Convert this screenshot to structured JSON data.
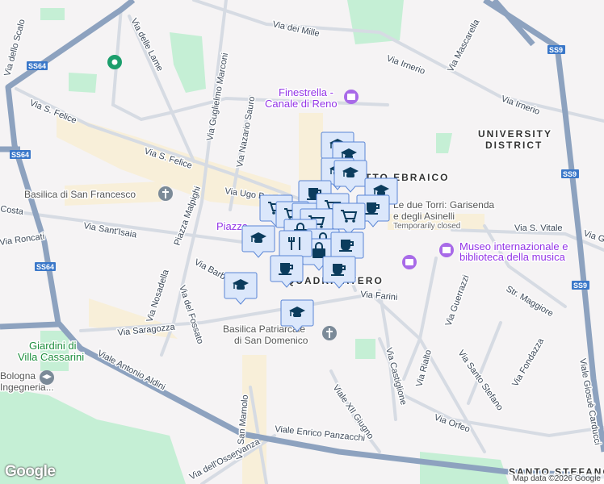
{
  "map": {
    "streets": [
      "Via dello Scalo",
      "Via delle Lame",
      "Via dei Mille",
      "Via Irnerio",
      "Via Irnerio",
      "Via Mascarella",
      "Via S. Felice",
      "Via S. Felice",
      "Via Guglielmo Marconi",
      "Via Nazario Sauro",
      "Via Ugo Bassi",
      "Via Sant'Isaia",
      "Via Roncati",
      "Piazza Malpighi",
      "Via Nosadella",
      "Via del Fossato",
      "Via Barberia",
      "Via Saragozza",
      "Viale Antonio Aldini",
      "Viale Enrico Panzacchi",
      "Via Farini",
      "Via Castiglione",
      "Via Rialto",
      "Via Guerrazzi",
      "Via Santo Stefano",
      "Via Fondazza",
      "Str. Maggiore",
      "Via S. Vitale",
      "Via Orfeo",
      "Viale XII Giugno",
      "Viale Giosuè Carducci",
      "Via San Mamolo",
      "Via dell'Osservanza",
      "Costa",
      "Via G"
    ],
    "highway_shields": [
      "SS64",
      "SS64",
      "SS64",
      "SS9",
      "SS9",
      "SS9"
    ],
    "districts": [
      "UNIVERSITY",
      "DISTRICT",
      "GHETTO EBRAICO",
      "QUADRILATERO",
      "SANTO STEFANO"
    ],
    "places": {
      "finestrella_1": "Finestrella -",
      "finestrella_2": "Canale di Reno",
      "basilica_sf": "Basilica di San Francesco",
      "piazza": "Piazza",
      "torri_1": "Le due Torri: Garisenda",
      "torri_2": "e degli Asinelli",
      "torri_status": "Temporarily closed",
      "museo_1": "Museo internazionale e",
      "museo_2": "biblioteca della musica",
      "basilica_sd_1": "Basilica Patriarcale",
      "basilica_sd_2": "di San Domenico",
      "giardini_1": "Giardini di",
      "giardini_2": "Villa Cassarini",
      "bologna_1": "Bologna",
      "bologna_2": "Ingegneria..."
    },
    "markers": [
      "graduation-cap",
      "graduation-cap",
      "graduation-cap",
      "graduation-cap",
      "graduation-cap",
      "coffee",
      "coffee",
      "shopping-cart",
      "shopping-cart",
      "shopping-cart",
      "shopping-cart",
      "shopping-cart",
      "shopping-cart",
      "graduation-cap",
      "shopping-bag",
      "shopping-bag",
      "shopping-bag",
      "fork-knife",
      "coffee",
      "coffee",
      "coffee",
      "graduation-cap",
      "graduation-cap"
    ],
    "colors": {
      "marker_fill": "#dbe7fb",
      "marker_border": "#5a86d6",
      "marker_icon": "#0b3c5d",
      "highway": "#8da2bf",
      "road": "#d6dbe3",
      "park": "#c5efd5",
      "commercial": "#f8efd9"
    }
  },
  "footer": {
    "logo": "Google",
    "attribution": "Map data ©2026 Google"
  }
}
